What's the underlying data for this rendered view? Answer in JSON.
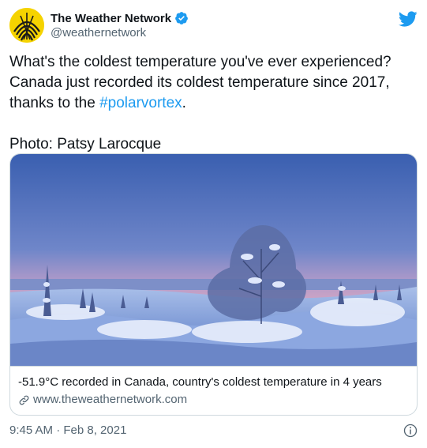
{
  "account": {
    "display_name": "The Weather Network",
    "handle": "@weathernetwork",
    "verified": true
  },
  "tweet": {
    "text_before_hashtag": "What's the coldest temperature you've ever experienced?  Canada just recorded its coldest temperature since 2017, thanks to the ",
    "hashtag": "#polarvortex",
    "text_after_hashtag": ".\n\nPhoto: Patsy Larocque"
  },
  "card": {
    "title": "-51.9°C recorded in Canada, country's coldest temperature in 4 years",
    "domain": "www.theweathernetwork.com"
  },
  "meta": {
    "timestamp": "9:45 AM · Feb 8, 2021"
  },
  "colors": {
    "accent": "#1d9bf0",
    "avatar": "#f5d300",
    "secondary_text": "#536471"
  },
  "icons": [
    "weather-network-logo",
    "verified-badge-icon",
    "twitter-bird-icon",
    "link-icon",
    "info-icon"
  ]
}
